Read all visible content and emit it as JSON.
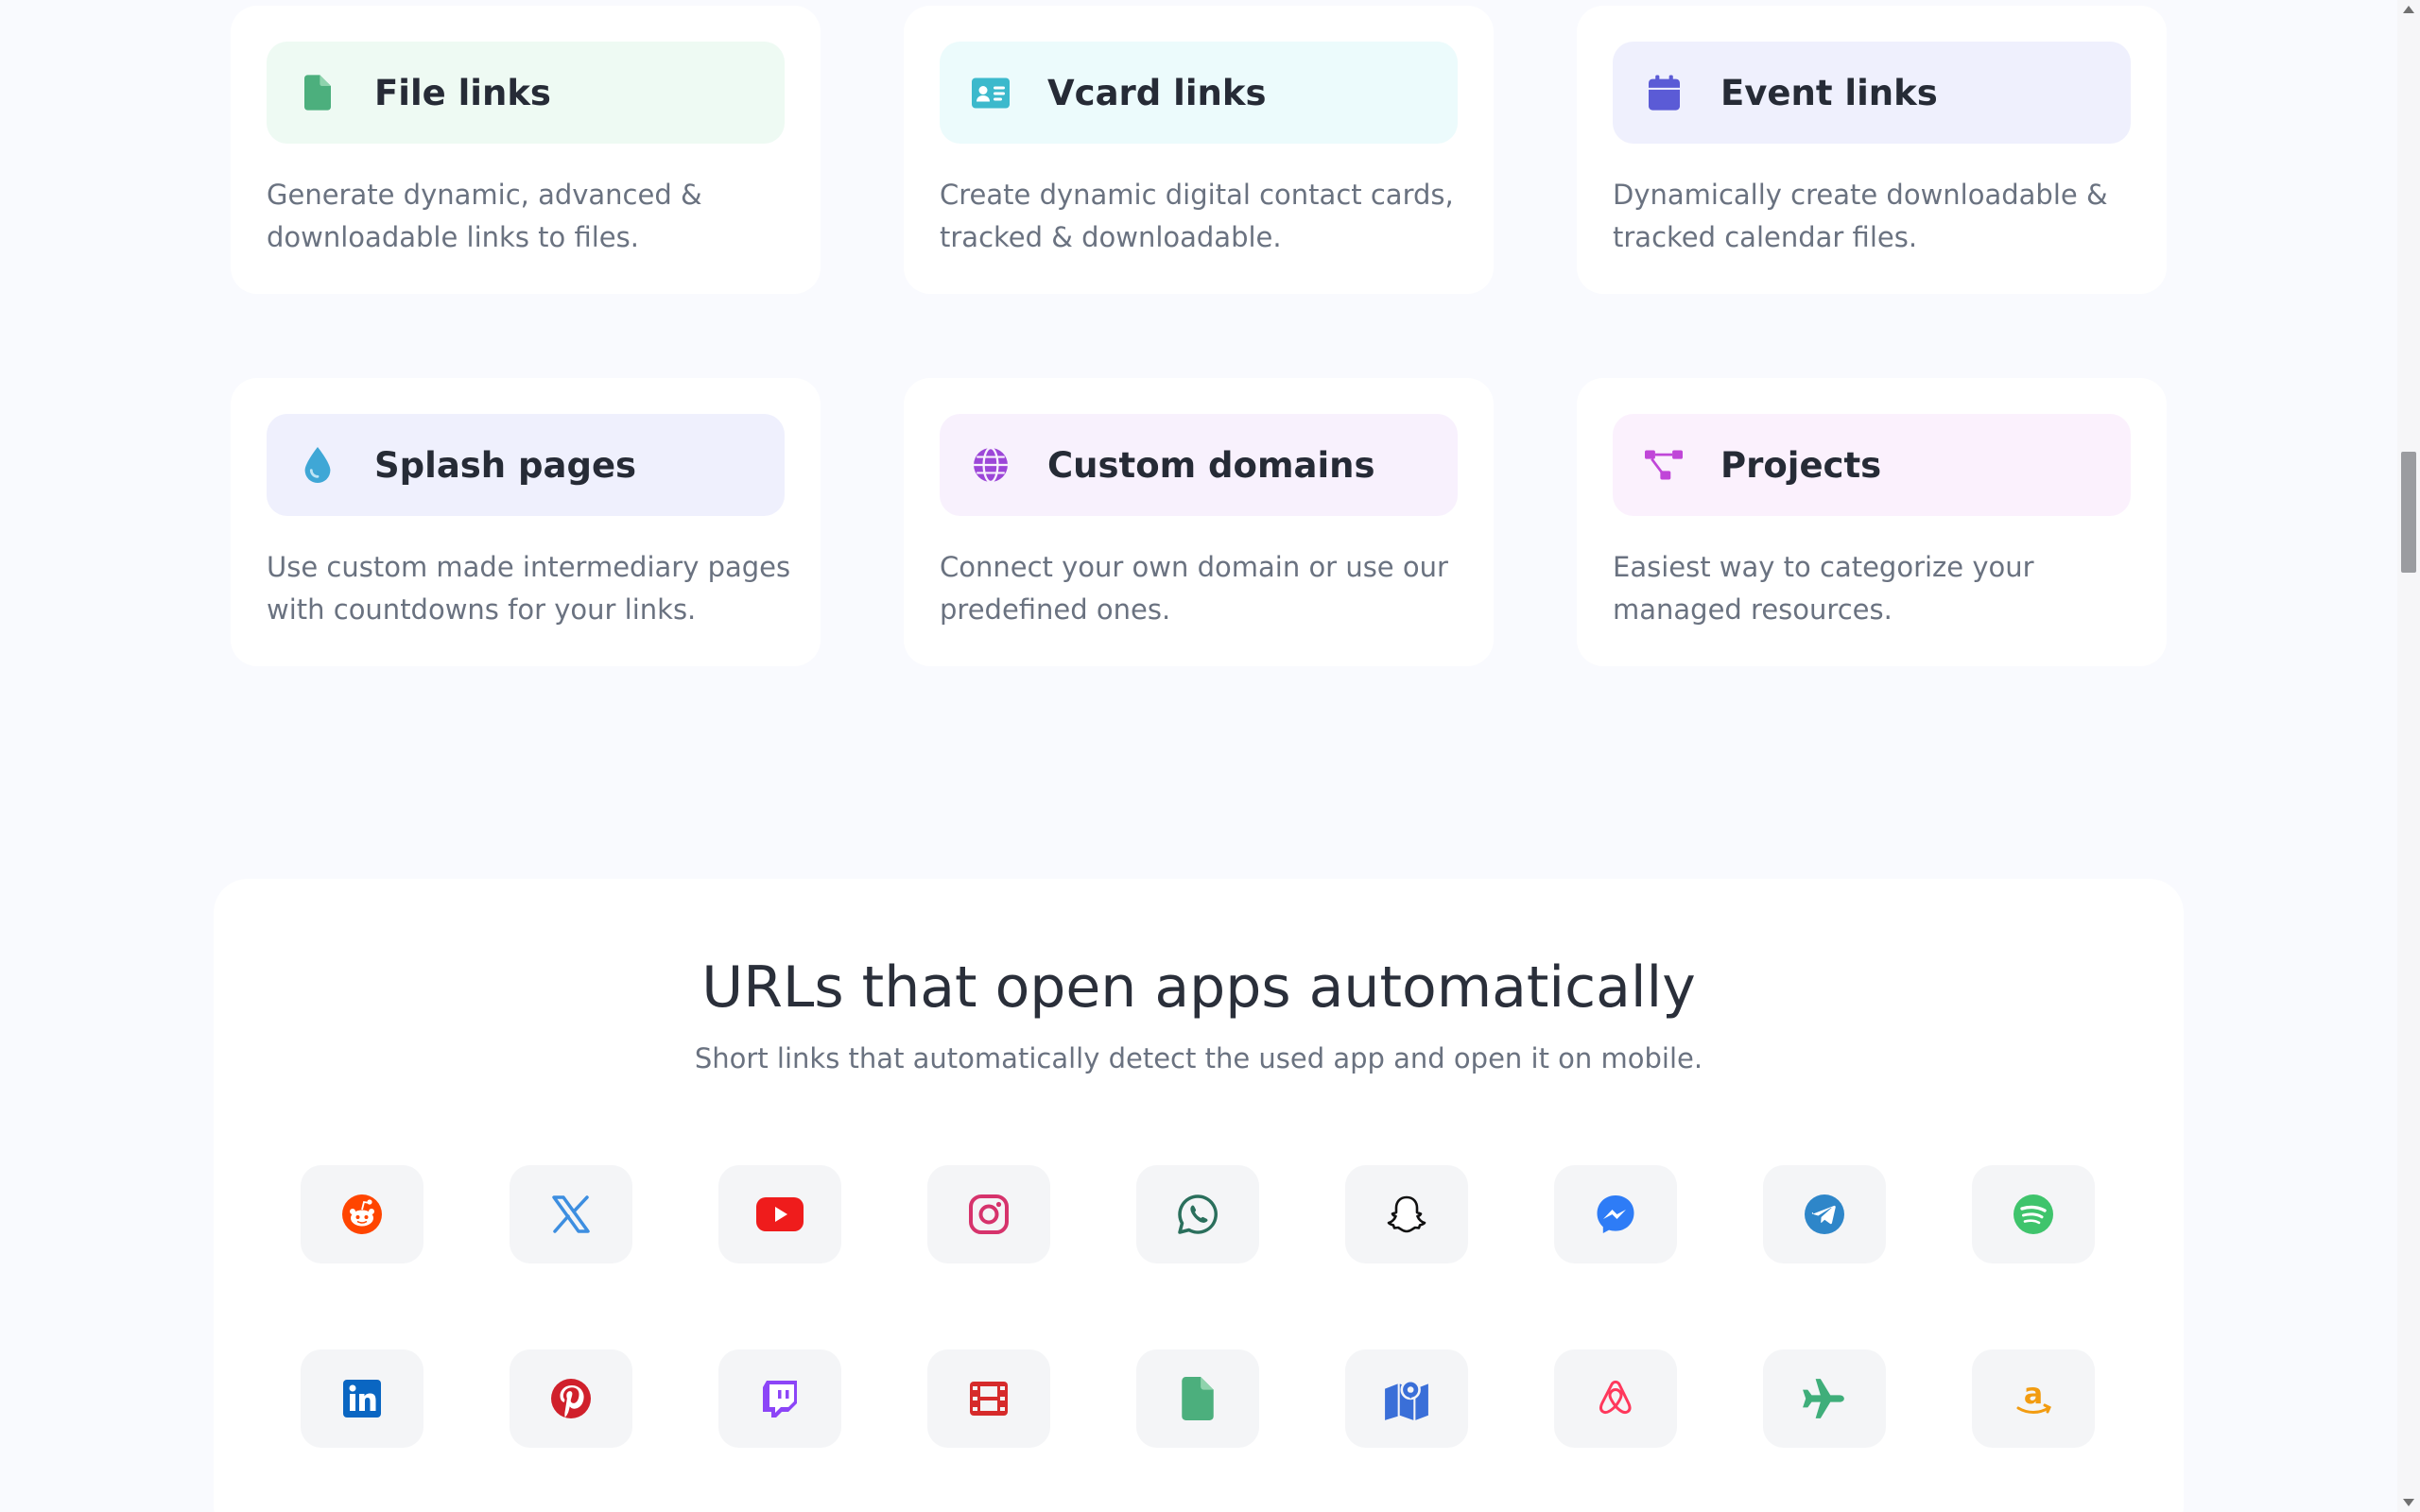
{
  "features": [
    {
      "id": "file-links",
      "title": "File links",
      "desc": "Generate dynamic, advanced & downloadable links to files.",
      "icon": "file-icon",
      "accent": "#4caf7d",
      "tint": "#eefaf3"
    },
    {
      "id": "vcard-links",
      "title": "Vcard links",
      "desc": "Create dynamic digital contact cards, tracked & downloadable.",
      "icon": "vcard-icon",
      "accent": "#3cb9cc",
      "tint": "#ecfbfc"
    },
    {
      "id": "event-links",
      "title": "Event links",
      "desc": "Dynamically create downloadable & tracked calendar files.",
      "icon": "calendar-icon",
      "accent": "#5b5bd6",
      "tint": "#eff0fd"
    },
    {
      "id": "splash-pages",
      "title": "Splash pages",
      "desc": "Use custom made intermediary pages with countdowns for your links.",
      "icon": "droplet-icon",
      "accent": "#3fa7d6",
      "tint": "#eff0fd"
    },
    {
      "id": "custom-domains",
      "title": "Custom domains",
      "desc": "Connect your own domain or use our predefined ones.",
      "icon": "globe-icon",
      "accent": "#9c46d8",
      "tint": "#f8f1fd"
    },
    {
      "id": "projects",
      "title": "Projects",
      "desc": "Easiest way to categorize your managed resources.",
      "icon": "project-diagram-icon",
      "accent": "#c046d8",
      "tint": "#fbf1fd"
    }
  ],
  "apps_section": {
    "title": "URLs that open apps automatically",
    "subtitle": "Short links that automatically detect the used app and open it on mobile."
  },
  "apps": [
    {
      "name": "reddit",
      "icon": "reddit-icon",
      "color": "#ff4500"
    },
    {
      "name": "x",
      "icon": "x-twitter-icon",
      "color": "#3d8ee0"
    },
    {
      "name": "youtube",
      "icon": "youtube-icon",
      "color": "#ef1c1c"
    },
    {
      "name": "instagram",
      "icon": "instagram-icon",
      "color": "#d6336c"
    },
    {
      "name": "whatsapp",
      "icon": "whatsapp-icon",
      "color": "#2a6f5c"
    },
    {
      "name": "snapchat",
      "icon": "snapchat-icon",
      "color": "#111111"
    },
    {
      "name": "messenger",
      "icon": "messenger-icon",
      "color": "#2e7cf6"
    },
    {
      "name": "telegram",
      "icon": "telegram-icon",
      "color": "#2e86c9"
    },
    {
      "name": "spotify",
      "icon": "spotify-icon",
      "color": "#3fc46c"
    },
    {
      "name": "linkedin",
      "icon": "linkedin-icon",
      "color": "#0a66c2"
    },
    {
      "name": "pinterest",
      "icon": "pinterest-icon",
      "color": "#d0202b"
    },
    {
      "name": "twitch",
      "icon": "twitch-icon",
      "color": "#8c45f7"
    },
    {
      "name": "video",
      "icon": "film-icon",
      "color": "#d62b2b"
    },
    {
      "name": "file",
      "icon": "file-icon",
      "color": "#4caf7d"
    },
    {
      "name": "maps",
      "icon": "map-icon",
      "color": "#3a6fd8"
    },
    {
      "name": "airbnb",
      "icon": "airbnb-icon",
      "color": "#ff385c"
    },
    {
      "name": "travel",
      "icon": "plane-icon",
      "color": "#3fae7a"
    },
    {
      "name": "amazon",
      "icon": "amazon-icon",
      "color": "#f29c11"
    }
  ]
}
